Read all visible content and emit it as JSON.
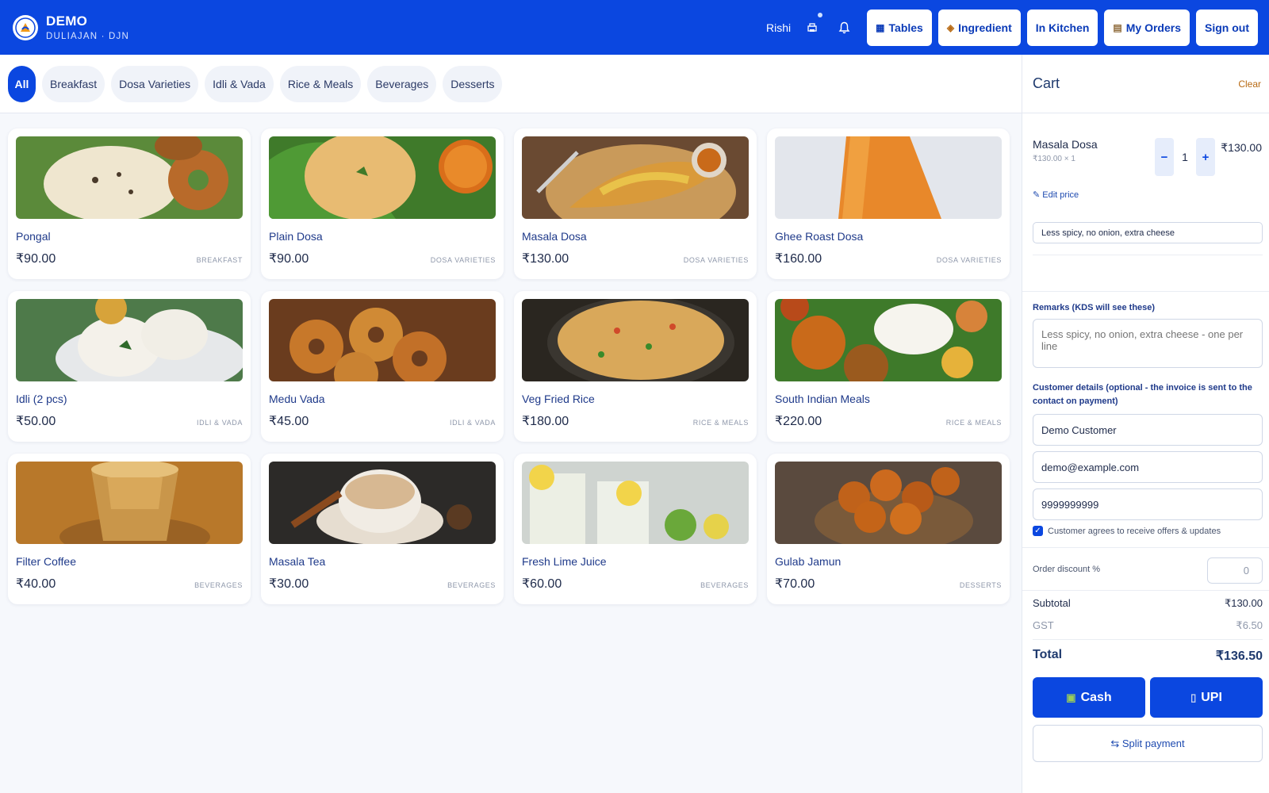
{
  "brand": {
    "name": "DEMO",
    "location": "DULIAJAN · DJN"
  },
  "header": {
    "user": "Rishi",
    "buttons": [
      {
        "label": "Tables",
        "icon": "table-icon"
      },
      {
        "label": "Ingredient",
        "icon": "box-icon"
      },
      {
        "label": "In Kitchen"
      },
      {
        "label": "My Orders",
        "icon": "clipboard-icon"
      },
      {
        "label": "Sign out"
      }
    ]
  },
  "categories": [
    "All",
    "Breakfast",
    "Dosa Varieties",
    "Idli & Vada",
    "Rice & Meals",
    "Beverages",
    "Desserts"
  ],
  "menu": [
    {
      "name": "Pongal",
      "price": "₹90.00",
      "category": "BREAKFAST"
    },
    {
      "name": "Plain Dosa",
      "price": "₹90.00",
      "category": "DOSA VARIETIES"
    },
    {
      "name": "Masala Dosa",
      "price": "₹130.00",
      "category": "DOSA VARIETIES"
    },
    {
      "name": "Ghee Roast Dosa",
      "price": "₹160.00",
      "category": "DOSA VARIETIES"
    },
    {
      "name": "Idli (2 pcs)",
      "price": "₹50.00",
      "category": "IDLI & VADA"
    },
    {
      "name": "Medu Vada",
      "price": "₹45.00",
      "category": "IDLI & VADA"
    },
    {
      "name": "Veg Fried Rice",
      "price": "₹180.00",
      "category": "RICE & MEALS"
    },
    {
      "name": "South Indian Meals",
      "price": "₹220.00",
      "category": "RICE & MEALS"
    },
    {
      "name": "Filter Coffee",
      "price": "₹40.00",
      "category": "BEVERAGES"
    },
    {
      "name": "Masala Tea",
      "price": "₹30.00",
      "category": "BEVERAGES"
    },
    {
      "name": "Fresh Lime Juice",
      "price": "₹60.00",
      "category": "BEVERAGES"
    },
    {
      "name": "Gulab Jamun",
      "price": "₹70.00",
      "category": "DESSERTS"
    }
  ],
  "cart": {
    "title": "Cart",
    "clear": "Clear",
    "item": {
      "name": "Masala Dosa",
      "sub": "₹130.00 × 1",
      "qty": "1",
      "minus": "−",
      "plus": "+",
      "total": "₹130.00",
      "note": "Less spicy, no onion, extra cheese"
    },
    "edit_price": "✎ Edit price",
    "remarks_label": "Remarks (KDS will see these)",
    "remarks_placeholder": "Less spicy, no onion, extra cheese - one per line",
    "customer_label": "Customer details (optional - the invoice is sent to the contact on payment)",
    "customer_name": "Demo Customer",
    "customer_email": "demo@example.com",
    "customer_phone": "9999999999",
    "agree_text": "Customer agrees to receive offers & updates",
    "discount_label": "Order discount %",
    "discount_value": "0",
    "subtotal_label": "Subtotal",
    "subtotal": "₹130.00",
    "gst_label": "GST",
    "gst": "₹6.50",
    "total_label": "Total",
    "total": "₹136.50",
    "cash": "Cash",
    "upi": "UPI",
    "split": "⇆ Split payment"
  },
  "colors": {
    "primary": "#0b47e0",
    "clear": "#b86a13"
  }
}
